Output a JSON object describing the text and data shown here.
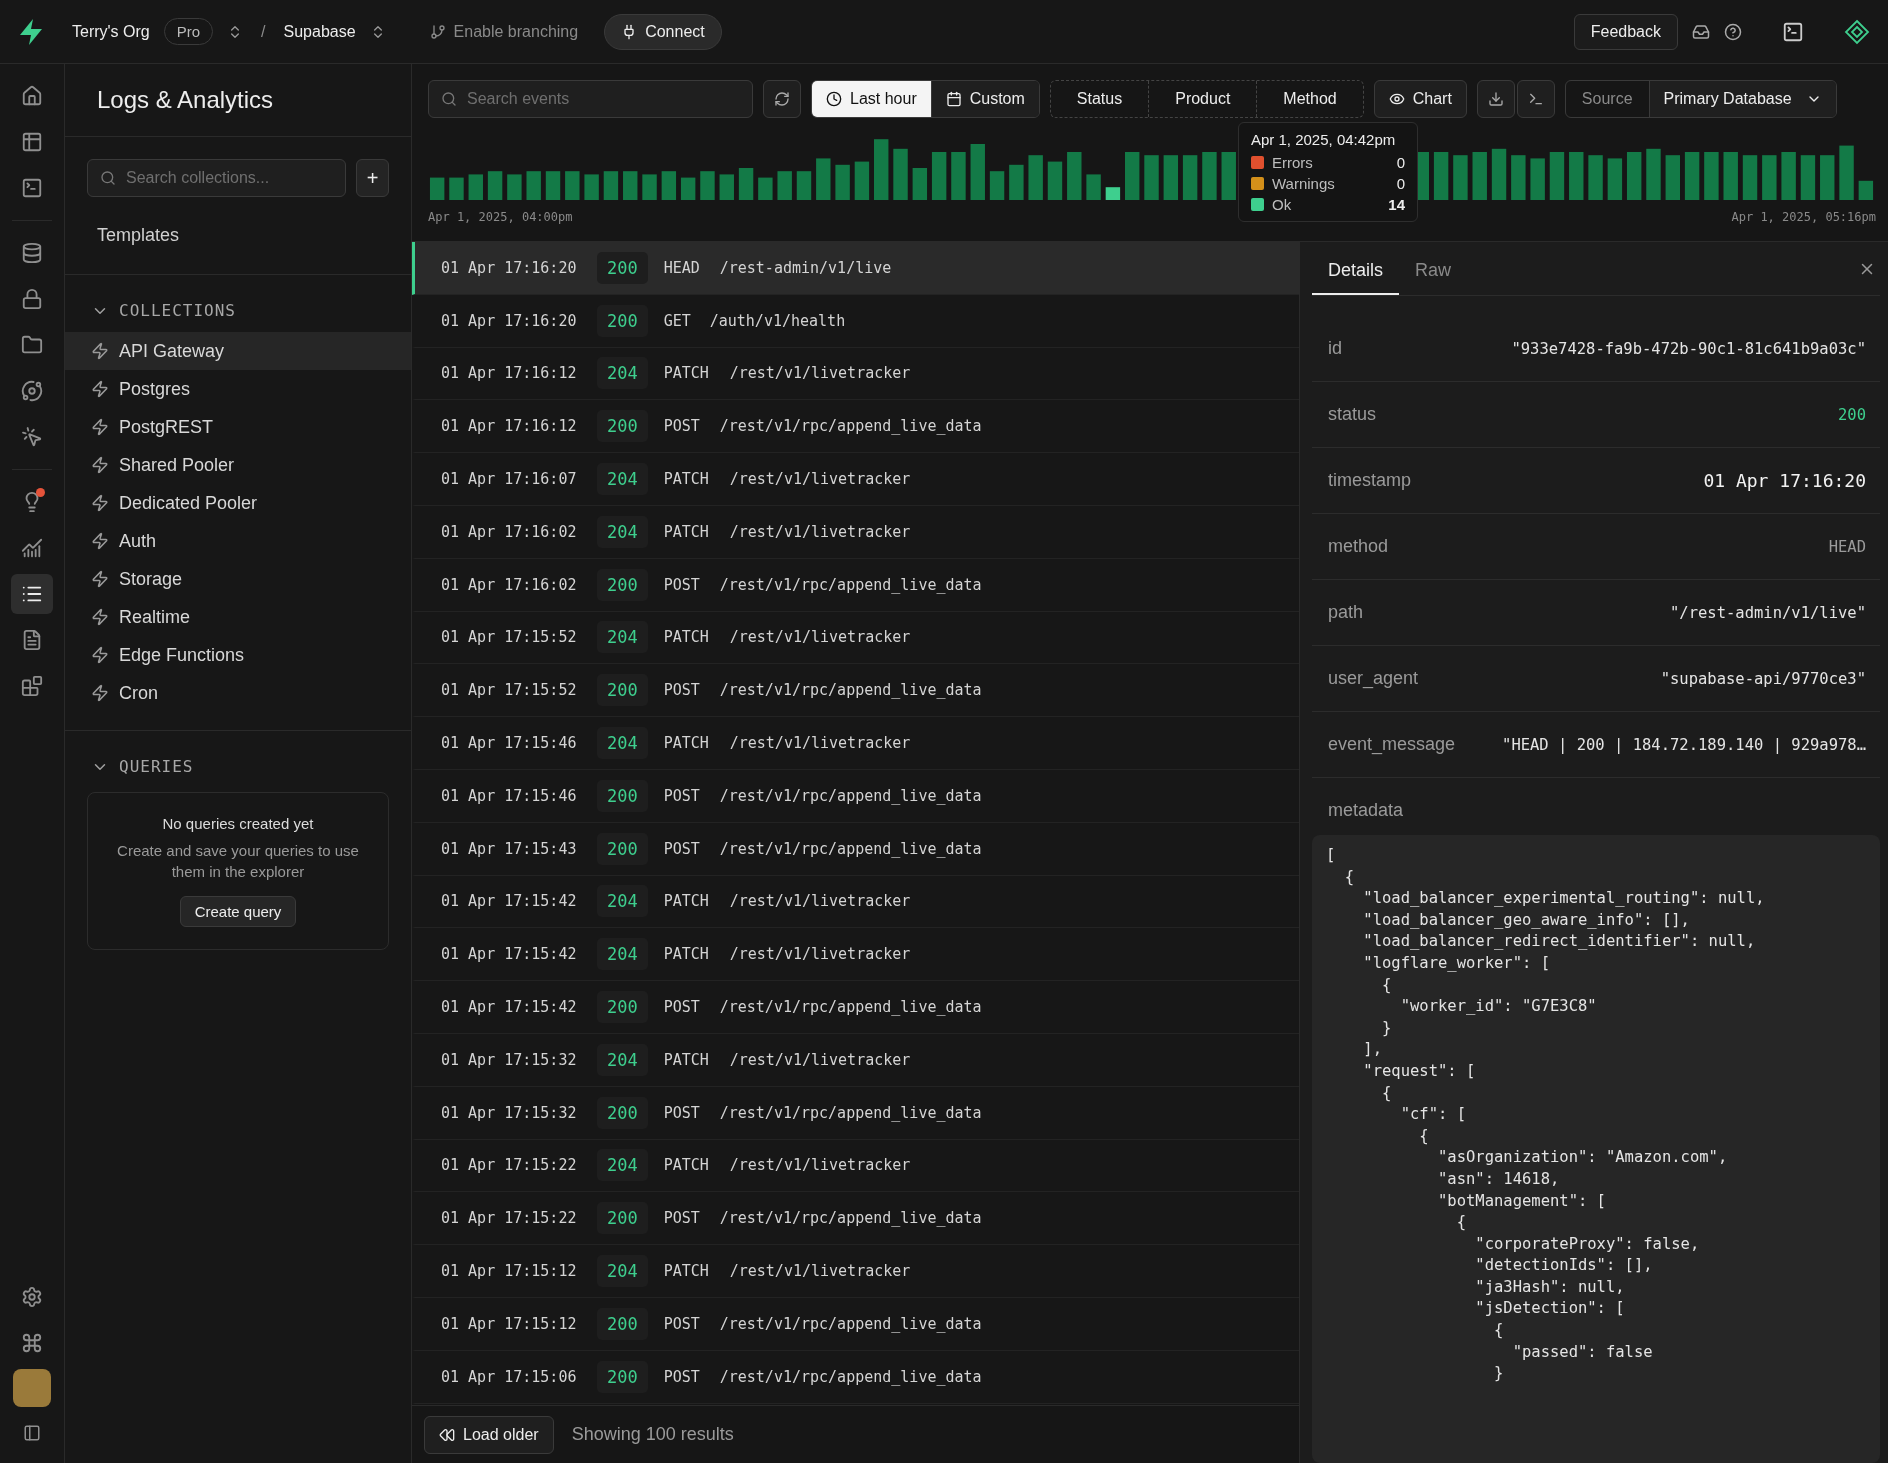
{
  "topbar": {
    "org": "Terry's Org",
    "plan": "Pro",
    "separator": "/",
    "project": "Supabase",
    "branching": "Enable branching",
    "connect": "Connect",
    "feedback": "Feedback"
  },
  "rail": [
    {
      "selected": false,
      "alert": false
    },
    {
      "selected": false,
      "alert": false
    },
    {
      "selected": false,
      "alert": false
    },
    {
      "selected": false,
      "alert": false
    },
    {
      "selected": false,
      "alert": false
    },
    {
      "selected": false,
      "alert": false
    },
    {
      "selected": false,
      "alert": false
    },
    {
      "selected": false,
      "alert": false
    },
    {
      "selected": false,
      "alert": true
    },
    {
      "selected": false,
      "alert": false
    },
    {
      "selected": true,
      "alert": false
    },
    {
      "selected": false,
      "alert": false
    },
    {
      "selected": false,
      "alert": false
    }
  ],
  "sidebar": {
    "title": "Logs & Analytics",
    "search_placeholder": "Search collections...",
    "add": "+",
    "templates": "Templates",
    "collections_label": "COLLECTIONS",
    "collections": [
      {
        "label": "API Gateway",
        "selected": true
      },
      {
        "label": "Postgres",
        "selected": false
      },
      {
        "label": "PostgREST",
        "selected": false
      },
      {
        "label": "Shared Pooler",
        "selected": false
      },
      {
        "label": "Dedicated Pooler",
        "selected": false
      },
      {
        "label": "Auth",
        "selected": false
      },
      {
        "label": "Storage",
        "selected": false
      },
      {
        "label": "Realtime",
        "selected": false
      },
      {
        "label": "Edge Functions",
        "selected": false
      },
      {
        "label": "Cron",
        "selected": false
      }
    ],
    "queries_label": "QUERIES",
    "queries_empty": {
      "title": "No queries created yet",
      "text": "Create and save your queries to use them in the explorer",
      "button": "Create query"
    }
  },
  "toolbar": {
    "search_placeholder": "Search events",
    "ranges": [
      {
        "label": "Last hour",
        "selected": true
      },
      {
        "label": "Custom",
        "selected": false
      }
    ],
    "filters": [
      "Status",
      "Product",
      "Method"
    ],
    "chart": "Chart",
    "source_label": "Source",
    "source": "Primary Database"
  },
  "histogram": {
    "start": "Apr 1, 2025, 04:00pm",
    "end": "Apr 1, 2025, 05:16pm",
    "tooltip": {
      "title": "Apr 1, 2025, 04:42pm",
      "items": [
        {
          "label": "Errors",
          "value": "0",
          "color": "#e0502e"
        },
        {
          "label": "Warnings",
          "value": "0",
          "color": "#d4901a"
        },
        {
          "label": "Ok",
          "value": "14",
          "color": "#3ecf8e"
        }
      ]
    }
  },
  "rows": [
    {
      "time": "01 Apr 17:16:20",
      "status": "200",
      "method": "HEAD",
      "path": "/rest-admin/v1/live",
      "selected": true
    },
    {
      "time": "01 Apr 17:16:20",
      "status": "200",
      "method": "GET",
      "path": "/auth/v1/health",
      "selected": false
    },
    {
      "time": "01 Apr 17:16:12",
      "status": "204",
      "method": "PATCH",
      "path": "/rest/v1/livetracker",
      "selected": false
    },
    {
      "time": "01 Apr 17:16:12",
      "status": "200",
      "method": "POST",
      "path": "/rest/v1/rpc/append_live_data",
      "selected": false
    },
    {
      "time": "01 Apr 17:16:07",
      "status": "204",
      "method": "PATCH",
      "path": "/rest/v1/livetracker",
      "selected": false
    },
    {
      "time": "01 Apr 17:16:02",
      "status": "204",
      "method": "PATCH",
      "path": "/rest/v1/livetracker",
      "selected": false
    },
    {
      "time": "01 Apr 17:16:02",
      "status": "200",
      "method": "POST",
      "path": "/rest/v1/rpc/append_live_data",
      "selected": false
    },
    {
      "time": "01 Apr 17:15:52",
      "status": "204",
      "method": "PATCH",
      "path": "/rest/v1/livetracker",
      "selected": false
    },
    {
      "time": "01 Apr 17:15:52",
      "status": "200",
      "method": "POST",
      "path": "/rest/v1/rpc/append_live_data",
      "selected": false
    },
    {
      "time": "01 Apr 17:15:46",
      "status": "204",
      "method": "PATCH",
      "path": "/rest/v1/livetracker",
      "selected": false
    },
    {
      "time": "01 Apr 17:15:46",
      "status": "200",
      "method": "POST",
      "path": "/rest/v1/rpc/append_live_data",
      "selected": false
    },
    {
      "time": "01 Apr 17:15:43",
      "status": "200",
      "method": "POST",
      "path": "/rest/v1/rpc/append_live_data",
      "selected": false
    },
    {
      "time": "01 Apr 17:15:42",
      "status": "204",
      "method": "PATCH",
      "path": "/rest/v1/livetracker",
      "selected": false
    },
    {
      "time": "01 Apr 17:15:42",
      "status": "204",
      "method": "PATCH",
      "path": "/rest/v1/livetracker",
      "selected": false
    },
    {
      "time": "01 Apr 17:15:42",
      "status": "200",
      "method": "POST",
      "path": "/rest/v1/rpc/append_live_data",
      "selected": false
    },
    {
      "time": "01 Apr 17:15:32",
      "status": "204",
      "method": "PATCH",
      "path": "/rest/v1/livetracker",
      "selected": false
    },
    {
      "time": "01 Apr 17:15:32",
      "status": "200",
      "method": "POST",
      "path": "/rest/v1/rpc/append_live_data",
      "selected": false
    },
    {
      "time": "01 Apr 17:15:22",
      "status": "204",
      "method": "PATCH",
      "path": "/rest/v1/livetracker",
      "selected": false
    },
    {
      "time": "01 Apr 17:15:22",
      "status": "200",
      "method": "POST",
      "path": "/rest/v1/rpc/append_live_data",
      "selected": false
    },
    {
      "time": "01 Apr 17:15:12",
      "status": "204",
      "method": "PATCH",
      "path": "/rest/v1/livetracker",
      "selected": false
    },
    {
      "time": "01 Apr 17:15:12",
      "status": "200",
      "method": "POST",
      "path": "/rest/v1/rpc/append_live_data",
      "selected": false
    },
    {
      "time": "01 Apr 17:15:06",
      "status": "200",
      "method": "POST",
      "path": "/rest/v1/rpc/append_live_data",
      "selected": false
    }
  ],
  "footer": {
    "load_older": "Load older",
    "showing": "Showing 100 results"
  },
  "details": {
    "tabs": [
      {
        "label": "Details",
        "selected": true
      },
      {
        "label": "Raw",
        "selected": false
      }
    ],
    "fields": [
      {
        "key": "id",
        "value": "\"933e7428-fa9b-472b-90c1-81c641b9a03c\"",
        "kind": "text"
      },
      {
        "key": "status",
        "value": "200",
        "kind": "status"
      },
      {
        "key": "timestamp",
        "value": "01 Apr 17:16:20",
        "kind": "strong"
      },
      {
        "key": "method",
        "value": "HEAD",
        "kind": "muted"
      },
      {
        "key": "path",
        "value": "\"/rest-admin/v1/live\"",
        "kind": "text"
      },
      {
        "key": "user_agent",
        "value": "\"supabase-api/9770ce3\"",
        "kind": "text"
      },
      {
        "key": "event_message",
        "value": "\"HEAD | 200 | 184.72.189.140 | 929a978…",
        "kind": "text"
      }
    ],
    "metadata_label": "metadata",
    "metadata": [
      "[",
      "  {",
      "    \"load_balancer_experimental_routing\": null,",
      "    \"load_balancer_geo_aware_info\": [],",
      "    \"load_balancer_redirect_identifier\": null,",
      "    \"logflare_worker\": [",
      "      {",
      "        \"worker_id\": \"G7E3C8\"",
      "      }",
      "    ],",
      "    \"request\": [",
      "      {",
      "        \"cf\": [",
      "          {",
      "            \"asOrganization\": \"Amazon.com\",",
      "            \"asn\": 14618,",
      "            \"botManagement\": [",
      "              {",
      "                \"corporateProxy\": false,",
      "                \"detectionIds\": [],",
      "                \"ja3Hash\": null,",
      "                \"jsDetection\": [",
      "                  {",
      "                    \"passed\": false",
      "                  }"
    ]
  }
}
